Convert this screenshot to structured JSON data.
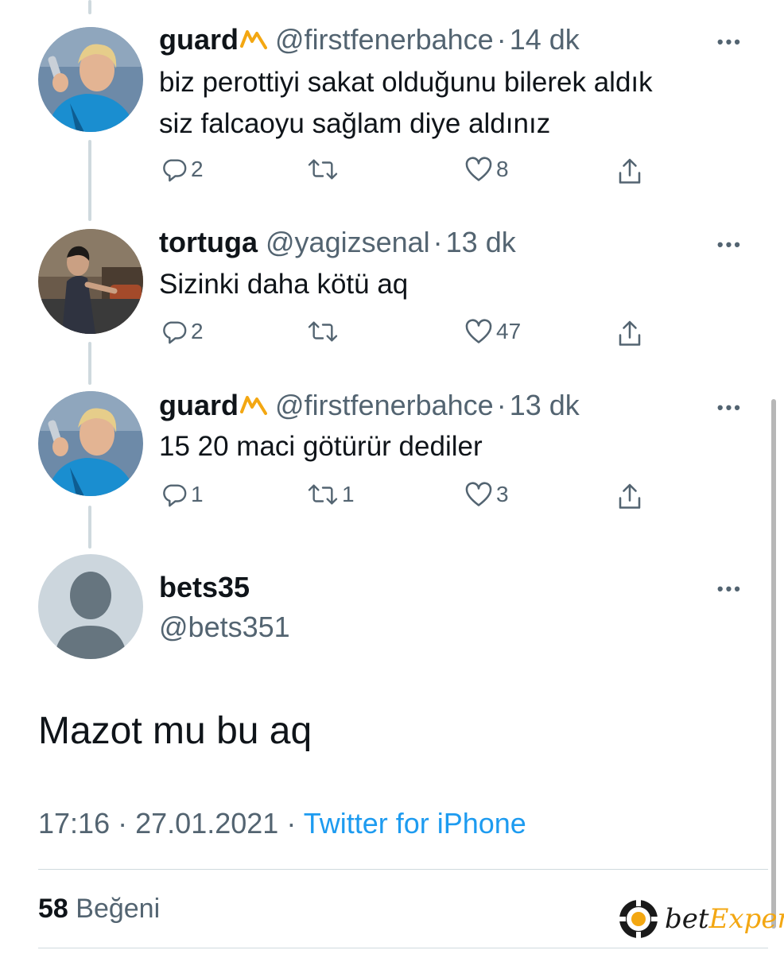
{
  "replies": [
    {
      "name": "guard",
      "handle": "@firstfenerbahce",
      "dot": "·",
      "time": "14 dk",
      "text": "biz perottiyi sakat olduğunu bilerek  aldık\nsiz falcaoyu sağlam diye aldınız",
      "reply_count": "2",
      "retweet_count": "",
      "like_count": "8",
      "more": "•••"
    },
    {
      "name": "tortuga",
      "handle": "@yagizsenal",
      "dot": "·",
      "time": "13 dk",
      "text": "Sizinki daha kötü aq",
      "reply_count": "2",
      "retweet_count": "",
      "like_count": "47",
      "more": "•••"
    },
    {
      "name": "guard",
      "handle": "@firstfenerbahce",
      "dot": "·",
      "time": "13 dk",
      "text": "15 20 maci götürür dediler",
      "reply_count": "1",
      "retweet_count": "1",
      "like_count": "3",
      "more": "•••"
    }
  ],
  "main_tweet": {
    "name": "bets35",
    "handle": "@bets351",
    "text": "Mazot mu bu aq",
    "time": "17:16",
    "separator": "·",
    "date": "27.01.2021",
    "source": "Twitter for iPhone",
    "like_count": "58",
    "like_label": "Beğeni",
    "more": "•••"
  },
  "watermark": {
    "prefix": "bet",
    "accent": "Exper"
  },
  "colors": {
    "text": "#0f1419",
    "secondary": "#536471",
    "link": "#1d9bf0",
    "thread_line": "#cfd9de",
    "emoji": "#f3a712"
  },
  "icons": [
    "reply-icon",
    "retweet-icon",
    "like-icon",
    "share-icon",
    "more-icon",
    "default-avatar-icon",
    "chip-logo-icon"
  ]
}
